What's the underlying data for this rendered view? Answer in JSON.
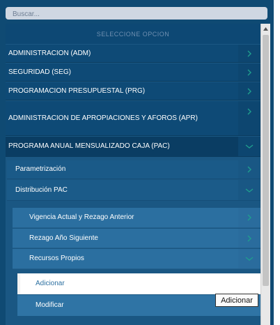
{
  "search": {
    "placeholder": "Buscar..."
  },
  "menu": {
    "header": "SELECCIONE OPCION",
    "items": [
      {
        "label": "ADMINISTRACION (ADM)"
      },
      {
        "label": "SEGURIDAD (SEG)"
      },
      {
        "label": "PROGRAMACION PRESUPUESTAL (PRG)"
      },
      {
        "label": "ADMINISTRACION DE APROPIACIONES Y AFOROS (APR)"
      },
      {
        "label": "PROGRAMA ANUAL MENSUALIZADO CAJA (PAC)"
      }
    ],
    "pac_children": [
      {
        "label": "Parametrización"
      },
      {
        "label": "Distribución PAC"
      }
    ],
    "distribucion_children": [
      {
        "label": "Vigencia Actual y Rezago Anterior"
      },
      {
        "label": "Rezago Año Siguiente"
      },
      {
        "label": "Recursos Propios"
      }
    ],
    "recursos_children": [
      {
        "label": "Adicionar"
      },
      {
        "label": "Modificar"
      }
    ]
  },
  "tooltip": {
    "text": "Adicionar"
  },
  "icons": {
    "collapsed": "chevron-right-icon",
    "expanded": "chevron-down-icon"
  },
  "colors": {
    "arrow": "#1f9e8e",
    "panel": "#0f4a73",
    "active_text": "#2b6fa0"
  }
}
